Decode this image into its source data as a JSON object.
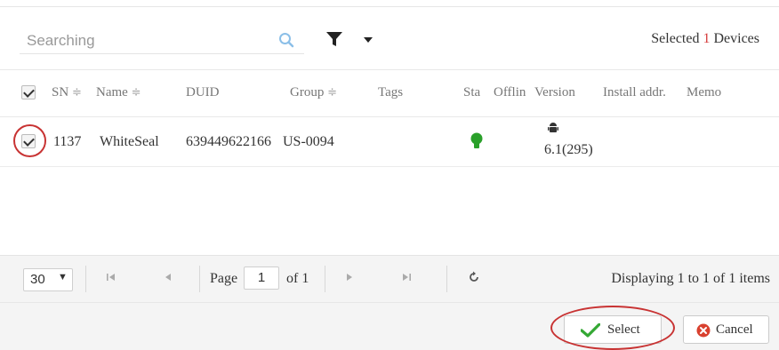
{
  "search": {
    "placeholder": "Searching"
  },
  "selection": {
    "prefix": "Selected",
    "count": "1",
    "suffix": "Devices"
  },
  "columns": {
    "sn": "SN",
    "name": "Name",
    "duid": "DUID",
    "group": "Group",
    "tags": "Tags",
    "status": "Sta",
    "offline": "Offlin",
    "version": "Version",
    "install_addr": "Install addr.",
    "memo": "Memo",
    "sort_glyph": "≑"
  },
  "rows": [
    {
      "checked": true,
      "sn": "1137",
      "name": "WhiteSeal",
      "duid": "639449622166",
      "group": "US-0094",
      "tags": "",
      "status_color": "#2aa02a",
      "version": "6.1(295)"
    }
  ],
  "pager": {
    "page_size": "30",
    "page_label": "Page",
    "page": "1",
    "of_label": "of 1",
    "display_text": "Displaying 1 to 1 of 1 items"
  },
  "buttons": {
    "select": "Select",
    "cancel": "Cancel"
  },
  "colors": {
    "accent_red": "#c83333",
    "ok_green": "#34a834",
    "cancel_red": "#d9412f"
  }
}
